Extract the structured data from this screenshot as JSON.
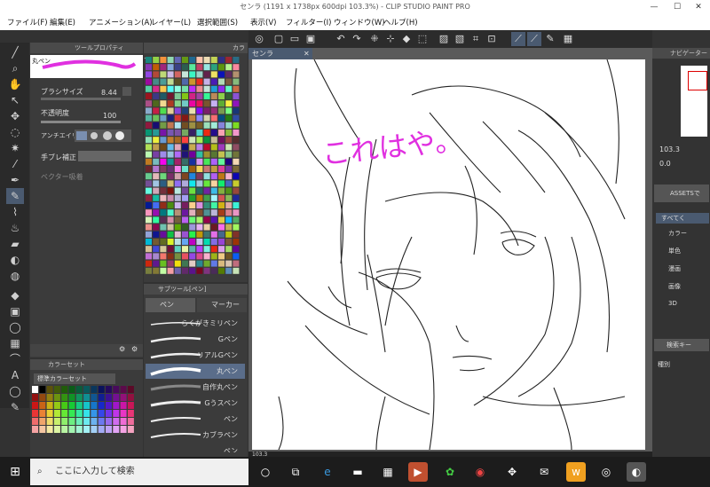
{
  "window": {
    "title": "センラ (1191 x 1738px 600dpi 103.3%) - CLIP STUDIO PAINT PRO"
  },
  "menu": [
    "ファイル(F)",
    "編集(E)",
    "アニメーション(A)",
    "レイヤー(L)",
    "選択範囲(S)",
    "表示(V)",
    "フィルター(I)",
    "ウィンドウ(W)",
    "ヘルプ(H)"
  ],
  "canvas": {
    "tab_label": "センラ",
    "handwritten_text": "これはや。",
    "zoom": "103.3"
  },
  "tool_property": {
    "panel_title": "ツールプロパティ",
    "tool_name": "丸ペン",
    "brush_size_label": "ブラシサイズ",
    "brush_size_value": "8.44",
    "opacity_label": "不透明度",
    "opacity_value": "100",
    "antialias_label": "アンチエイリアス",
    "stabilization_label": "手ブレ補正",
    "vector_label": "ベクター吸着"
  },
  "palette": {
    "panel_title": "カラー"
  },
  "sub_tool": {
    "panel_title": "サブツール[ペン]",
    "tabs": [
      "ペン",
      "マーカー"
    ],
    "items": [
      "らくがきミリペン",
      "Gペン",
      "リアルGペン",
      "丸ペン",
      "自作丸ペン",
      "Gうスペン",
      "ペン",
      "カブラペン",
      "ペン"
    ]
  },
  "color_set": {
    "panel_title": "カラーセット",
    "selected": "標準カラーセット"
  },
  "right_panel": {
    "navigator_title": "ナビゲーター",
    "value1": "103.3",
    "value2": "0.0",
    "assets_label": "ASSETSで",
    "tree": [
      "すべてく",
      "カラー",
      "単色",
      "漫画",
      "画像",
      "3D"
    ],
    "search_placeholder": "検索キー",
    "category_label": "種別"
  },
  "taskbar": {
    "search_placeholder": "ここに入力して検索"
  },
  "colors": {
    "pink": "#e030e0",
    "accent": "#4a7acc"
  }
}
